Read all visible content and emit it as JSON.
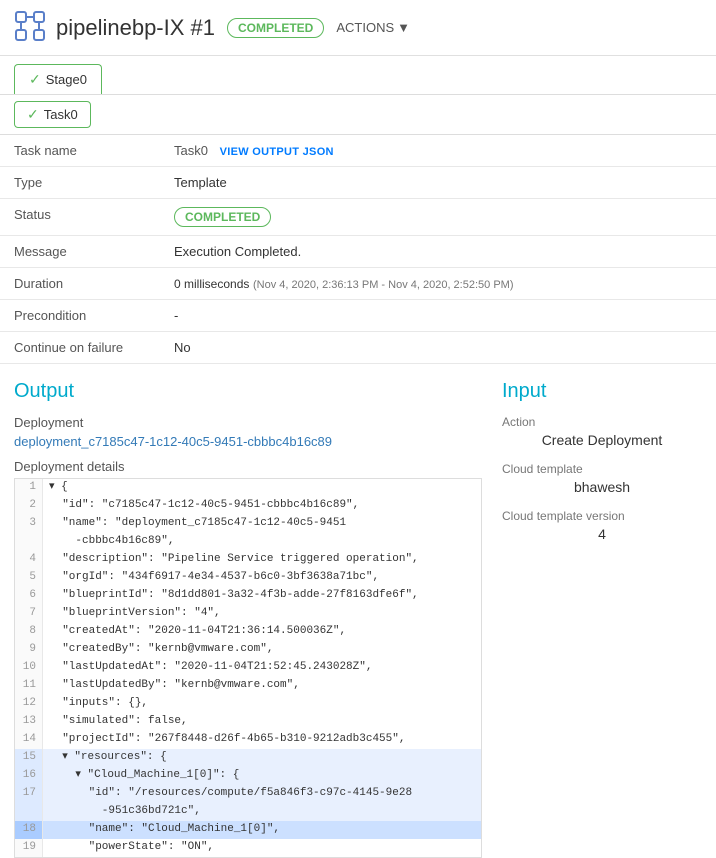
{
  "header": {
    "icon_alt": "pipeline-icon",
    "title": "pipelinebp-IX #1",
    "completed_badge": "COMPLETED",
    "actions_label": "ACTIONS"
  },
  "stage": {
    "tab_label": "Stage0",
    "check": "✓"
  },
  "task": {
    "tab_label": "Task0",
    "check": "✓"
  },
  "details": {
    "task_name_label": "Task name",
    "task_name_value": "Task0",
    "view_output_label": "VIEW OUTPUT JSON",
    "type_label": "Type",
    "type_value": "Template",
    "status_label": "Status",
    "status_value": "COMPLETED",
    "message_label": "Message",
    "message_value": "Execution Completed.",
    "duration_label": "Duration",
    "duration_value": "0 milliseconds",
    "duration_range": "(Nov 4, 2020, 2:36:13 PM - Nov 4, 2020, 2:52:50 PM)",
    "precondition_label": "Precondition",
    "precondition_value": "-",
    "continue_label": "Continue on failure",
    "continue_value": "No"
  },
  "output": {
    "title": "Output",
    "deployment_label": "Deployment",
    "deployment_link": "deployment_c7185c47-1c12-40c5-9451-cbbbc4b16c89",
    "deployment_details_label": "Deployment details",
    "code_lines": [
      {
        "num": 1,
        "content": "▾ {",
        "highlight": false,
        "selected": false
      },
      {
        "num": 2,
        "content": "  \"id\": \"c7185c47-1c12-40c5-9451-cbbbc4b16c89\",",
        "highlight": false,
        "selected": false
      },
      {
        "num": 3,
        "content": "  \"name\": \"deployment_c7185c47-1c12-40c5-9451",
        "highlight": false,
        "selected": false
      },
      {
        "num": 3,
        "content": "    -cbbbc4b16c89\",",
        "highlight": false,
        "selected": false,
        "continuation": true
      },
      {
        "num": 4,
        "content": "  \"description\": \"Pipeline Service triggered operation\",",
        "highlight": false,
        "selected": false
      },
      {
        "num": 5,
        "content": "  \"orgId\": \"434f6917-4e34-4537-b6c0-3bf3638a71bc\",",
        "highlight": false,
        "selected": false
      },
      {
        "num": 6,
        "content": "  \"blueprintId\": \"8d1dd801-3a32-4f3b-adde-27f8163dfe6f\",",
        "highlight": false,
        "selected": false
      },
      {
        "num": 7,
        "content": "  \"blueprintVersion\": \"4\",",
        "highlight": false,
        "selected": false
      },
      {
        "num": 8,
        "content": "  \"createdAt\": \"2020-11-04T21:36:14.500036Z\",",
        "highlight": false,
        "selected": false
      },
      {
        "num": 9,
        "content": "  \"createdBy\": \"kernb@vmware.com\",",
        "highlight": false,
        "selected": false
      },
      {
        "num": 10,
        "content": "  \"lastUpdatedAt\": \"2020-11-04T21:52:45.243028Z\",",
        "highlight": false,
        "selected": false
      },
      {
        "num": 11,
        "content": "  \"lastUpdatedBy\": \"kernb@vmware.com\",",
        "highlight": false,
        "selected": false
      },
      {
        "num": 12,
        "content": "  \"inputs\": {},",
        "highlight": false,
        "selected": false
      },
      {
        "num": 13,
        "content": "  \"simulated\": false,",
        "highlight": false,
        "selected": false
      },
      {
        "num": 14,
        "content": "  \"projectId\": \"267f8448-d26f-4b65-b310-9212adb3c455\",",
        "highlight": false,
        "selected": false
      },
      {
        "num": 15,
        "content": "  ▾ \"resources\": {",
        "highlight": true,
        "selected": false
      },
      {
        "num": 16,
        "content": "    ▾ \"Cloud_Machine_1[0]\": {",
        "highlight": true,
        "selected": false
      },
      {
        "num": 17,
        "content": "      \"id\": \"/resources/compute/f5a846f3-c97c-4145-9e28",
        "highlight": true,
        "selected": false
      },
      {
        "num": 17,
        "content": "        -951c36bd721c\",",
        "highlight": true,
        "selected": false,
        "continuation": true
      },
      {
        "num": 18,
        "content": "      \"name\": \"Cloud_Machine_1[0]\",",
        "highlight": false,
        "selected": true
      },
      {
        "num": 19,
        "content": "      \"powerState\": \"ON\",",
        "highlight": false,
        "selected": false
      }
    ]
  },
  "input": {
    "title": "Input",
    "action_label": "Action",
    "action_value": "Create Deployment",
    "cloud_template_label": "Cloud template",
    "cloud_template_value": "bhawesh",
    "cloud_template_version_label": "Cloud template version",
    "cloud_template_version_value": "4"
  }
}
